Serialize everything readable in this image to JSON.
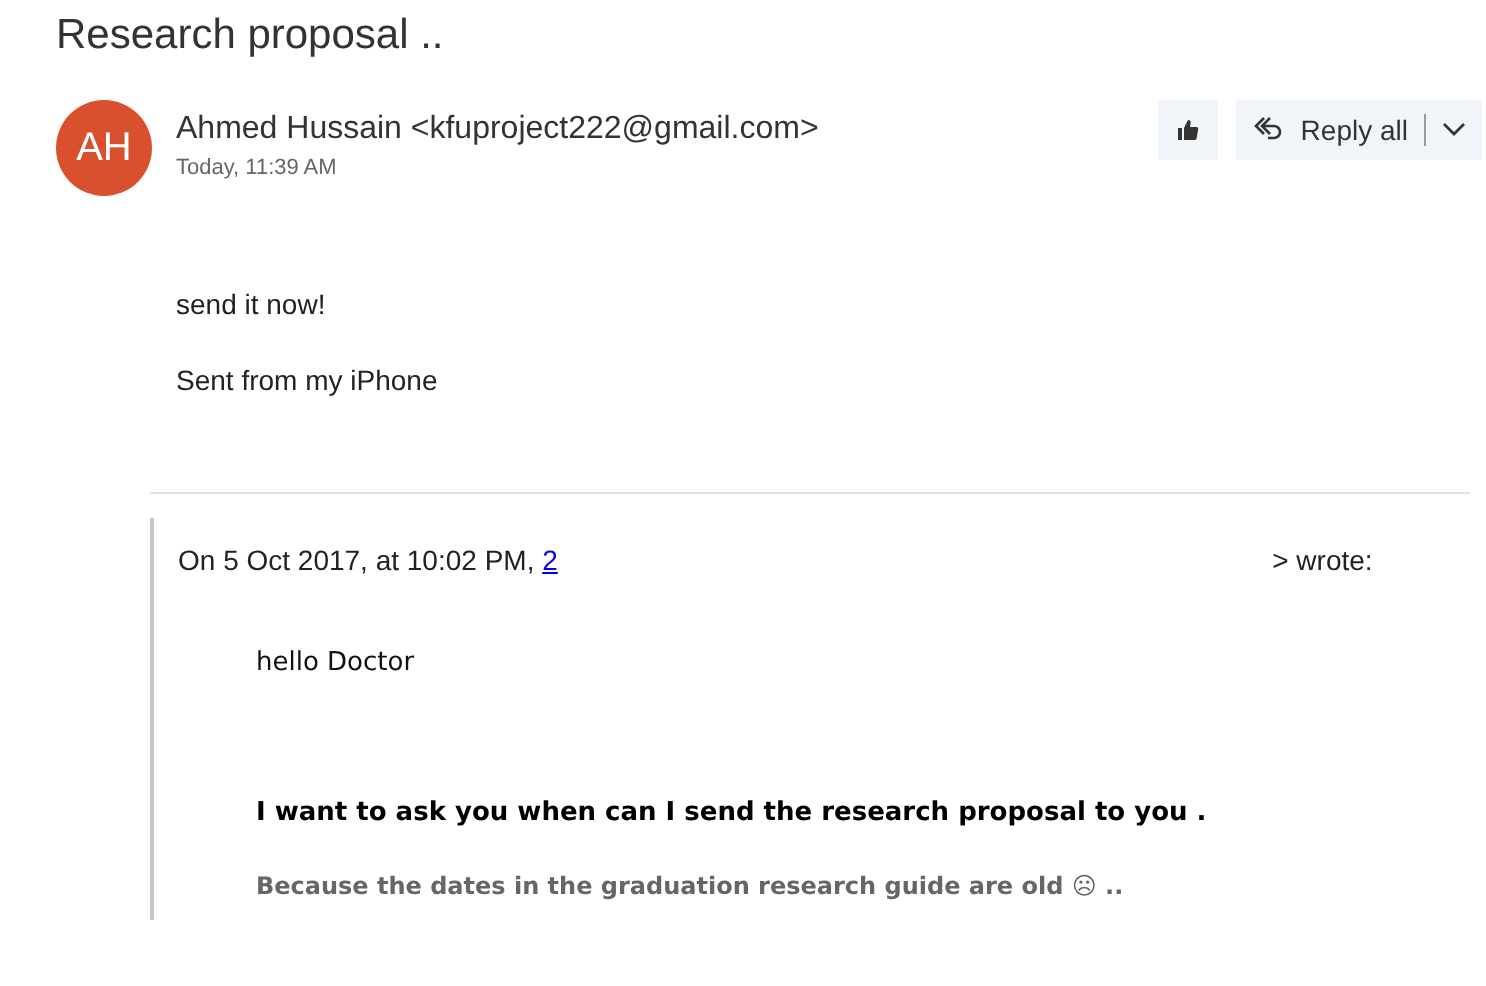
{
  "subject": "Research proposal ..",
  "sender": {
    "initials": "AH",
    "name": "Ahmed Hussain <kfuproject222@gmail.com>",
    "time": "Today, 11:39 AM"
  },
  "actions": {
    "reply_all": "Reply all"
  },
  "body": [
    "send it now!",
    "Sent from my iPhone"
  ],
  "quote": {
    "header_start": "On 5 Oct 2017, at 10:02 PM, ",
    "link": "2",
    "header_end": "> wrote:",
    "lines": [
      {
        "kind": "plain",
        "text": "hello Doctor"
      },
      {
        "kind": "bold",
        "text": "I want to ask you when can I send the research proposal to you ."
      },
      {
        "kind": "muted",
        "text": "Because the dates in the  graduation research guide are old ☹ .."
      }
    ]
  }
}
